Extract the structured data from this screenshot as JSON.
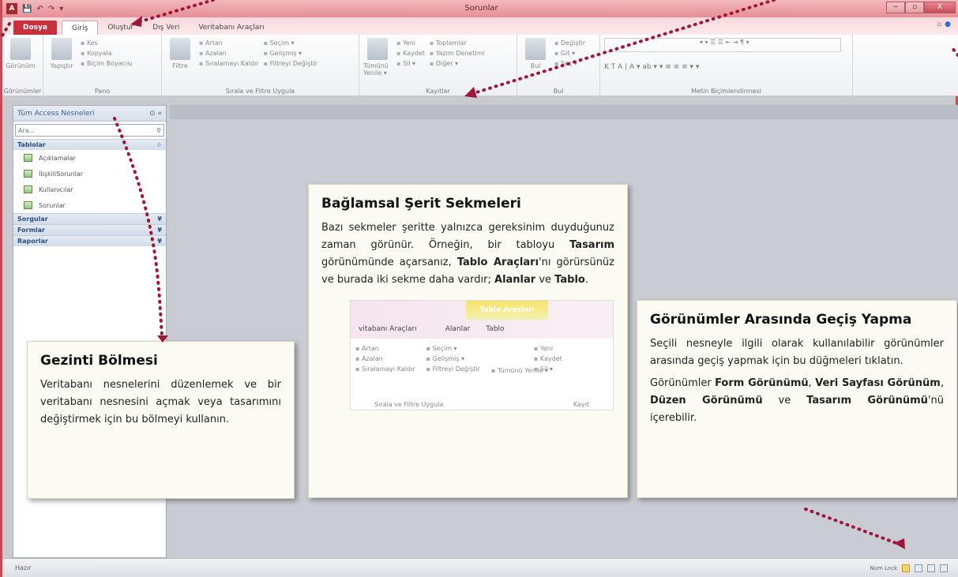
{
  "window": {
    "title": "Sorunlar",
    "app_icon": "A",
    "qat": [
      "💾",
      "↶",
      "↷",
      "▾"
    ],
    "controls": [
      "−",
      "▫",
      "X"
    ]
  },
  "tabs": [
    "Dosya",
    "Giriş",
    "Oluştur",
    "Dış Veri",
    "Veritabanı Araçları"
  ],
  "ribbon": {
    "groups": [
      {
        "label": "Görünümler",
        "big": [
          "Görünüm"
        ],
        "cols": []
      },
      {
        "label": "Pano",
        "big": [
          "Yapıştır"
        ],
        "cols": [
          [
            "Kes",
            "Kopyala",
            "Biçim Boyacısı"
          ]
        ]
      },
      {
        "label": "Sırala ve Filtre Uygula",
        "big": [
          "Filtre"
        ],
        "cols": [
          [
            "Artan",
            "Azalan",
            "Sıralamayı Kaldır"
          ],
          [
            "Seçim ▾",
            "Gelişmiş ▾",
            "Filtreyi Değiştir"
          ]
        ]
      },
      {
        "label": "Kayıtlar",
        "big": [
          "Tümünü Yenile ▾"
        ],
        "cols": [
          [
            "Yeni",
            "Kaydet",
            "Sil ▾"
          ],
          [
            "Toplamlar",
            "Yazım Denetimi",
            "Diğer ▾"
          ]
        ]
      },
      {
        "label": "Bul",
        "big": [
          "Bul"
        ],
        "cols": [
          [
            "Değiştir",
            "Git ▾",
            "Seç ▾"
          ]
        ]
      },
      {
        "label": "Metin Biçimlendirmesi",
        "big": [],
        "cols": [
          [
            "▾  ▾  ☰ ☰  ⇤ ⇥  ¶ ▾"
          ],
          [
            "K  T  A  |  A ▾  ab ▾  ▾  ≡ ≡ ≡  ▾  ▾"
          ]
        ]
      }
    ]
  },
  "nav": {
    "header": "Tüm Access Nesneleri",
    "header_icons": "⊙ «",
    "search_placeholder": "Ara...",
    "search_icon": "⚲",
    "categories": [
      {
        "name": "Tablolar",
        "icon": "☆"
      },
      {
        "name": "Sorgular",
        "icon": "¥"
      },
      {
        "name": "Formlar",
        "icon": "¥"
      },
      {
        "name": "Raporlar",
        "icon": "¥"
      }
    ],
    "tables": [
      "Açıklamalar",
      "İlişkiliSorunlar",
      "Kullanıcılar",
      "Sorunlar"
    ]
  },
  "status": {
    "left": "Hazır",
    "right": "Num Lock"
  },
  "callouts": {
    "nav": {
      "title": "Gezinti Bölmesi",
      "text": "Veritabanı nesnelerini düzenlemek ve bir veritabanı nesnesini açmak veya tasarımını değiştirmek için bu bölmeyi kullanın."
    },
    "context": {
      "title": "Bağlamsal Şerit Sekmeleri",
      "p1": "Bazı sekmeler şeritte yalnızca gereksinim duyduğunuz zaman görünür. Örneğin, bir tabloyu ",
      "b1": "Tasarım",
      "p2": " görünümünde açarsanız, ",
      "b2": "Tablo Araçları",
      "p3": "'nı görürsünüz ve burada iki sekme daha vardır; ",
      "b3": "Alanlar",
      "p4": " ve ",
      "b4": "Tablo",
      "p5": ".",
      "inset": {
        "context_tab": "Tablo Araçları",
        "tabs": [
          "vitabanı Araçları",
          "Alanlar",
          "Tablo"
        ],
        "col1": [
          "Artan",
          "Azalan",
          "Sıralamayı Kaldır"
        ],
        "col2": [
          "Seçim ▾",
          "Gelişmiş ▾",
          "Filtreyi Değiştir"
        ],
        "refresh": "Tümünü Yenile ▾",
        "col3": [
          "Yeni",
          "Kaydet",
          "Sil ▾"
        ],
        "group1": "Sırala ve Filtre Uygula",
        "group2": "Kayıt"
      }
    },
    "views": {
      "title": "Görünümler Arasında Geçiş Yapma",
      "p1": "Seçili nesneyle ilgili olarak kullanılabilir görünümler arasında geçiş yapmak için bu düğmeleri tıklatın.",
      "p2a": "Görünümler ",
      "b1": "Form Görünümü",
      "p2b": ", ",
      "b2": "Veri Sayfası Görünüm",
      "p2c": ", ",
      "b3": "Düzen Görünümü",
      "p2d": " ve ",
      "b4": "Tasarım Görünümü",
      "p2e": "'nü içerebilir."
    }
  },
  "colors": {
    "accent": "#c8303b",
    "arrow": "#a0163b"
  }
}
